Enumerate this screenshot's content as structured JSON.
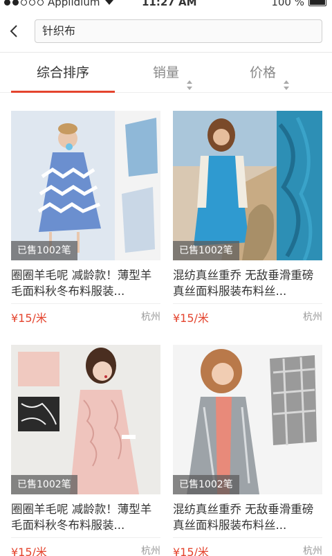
{
  "status_bar": {
    "carrier": "Applidium",
    "time": "11:27 AM",
    "battery": "100 %"
  },
  "search": {
    "query": "针织布"
  },
  "sort_tabs": [
    {
      "label": "综合排序",
      "active": true
    },
    {
      "label": "销量",
      "active": false
    },
    {
      "label": "价格",
      "active": false
    }
  ],
  "products": [
    {
      "sold": "已售1002笔",
      "title": "圈圈羊毛呢 减龄款！薄型羊毛面料秋冬布料服装...",
      "price": "¥15/米",
      "city": "杭州",
      "image": "model-in-zigzag-dress"
    },
    {
      "sold": "已售1002笔",
      "title": "混纺真丝重乔 无敌垂滑重磅真丝面料服装布料丝...",
      "price": "¥15/米",
      "city": "杭州",
      "image": "model-in-blue-dress"
    },
    {
      "sold": "已售1002笔",
      "title": "圈圈羊毛呢 减龄款！薄型羊毛面料秋冬布料服装...",
      "price": "¥15/米",
      "city": "杭州",
      "image": "model-in-pink-coat"
    },
    {
      "sold": "已售1002笔",
      "title": "混纺真丝重乔 无敌垂滑重磅真丝面料服装布料丝...",
      "price": "¥15/米",
      "city": "杭州",
      "image": "model-in-gray-jacket"
    }
  ],
  "colors": {
    "accent": "#e4442e",
    "muted": "#999999"
  }
}
